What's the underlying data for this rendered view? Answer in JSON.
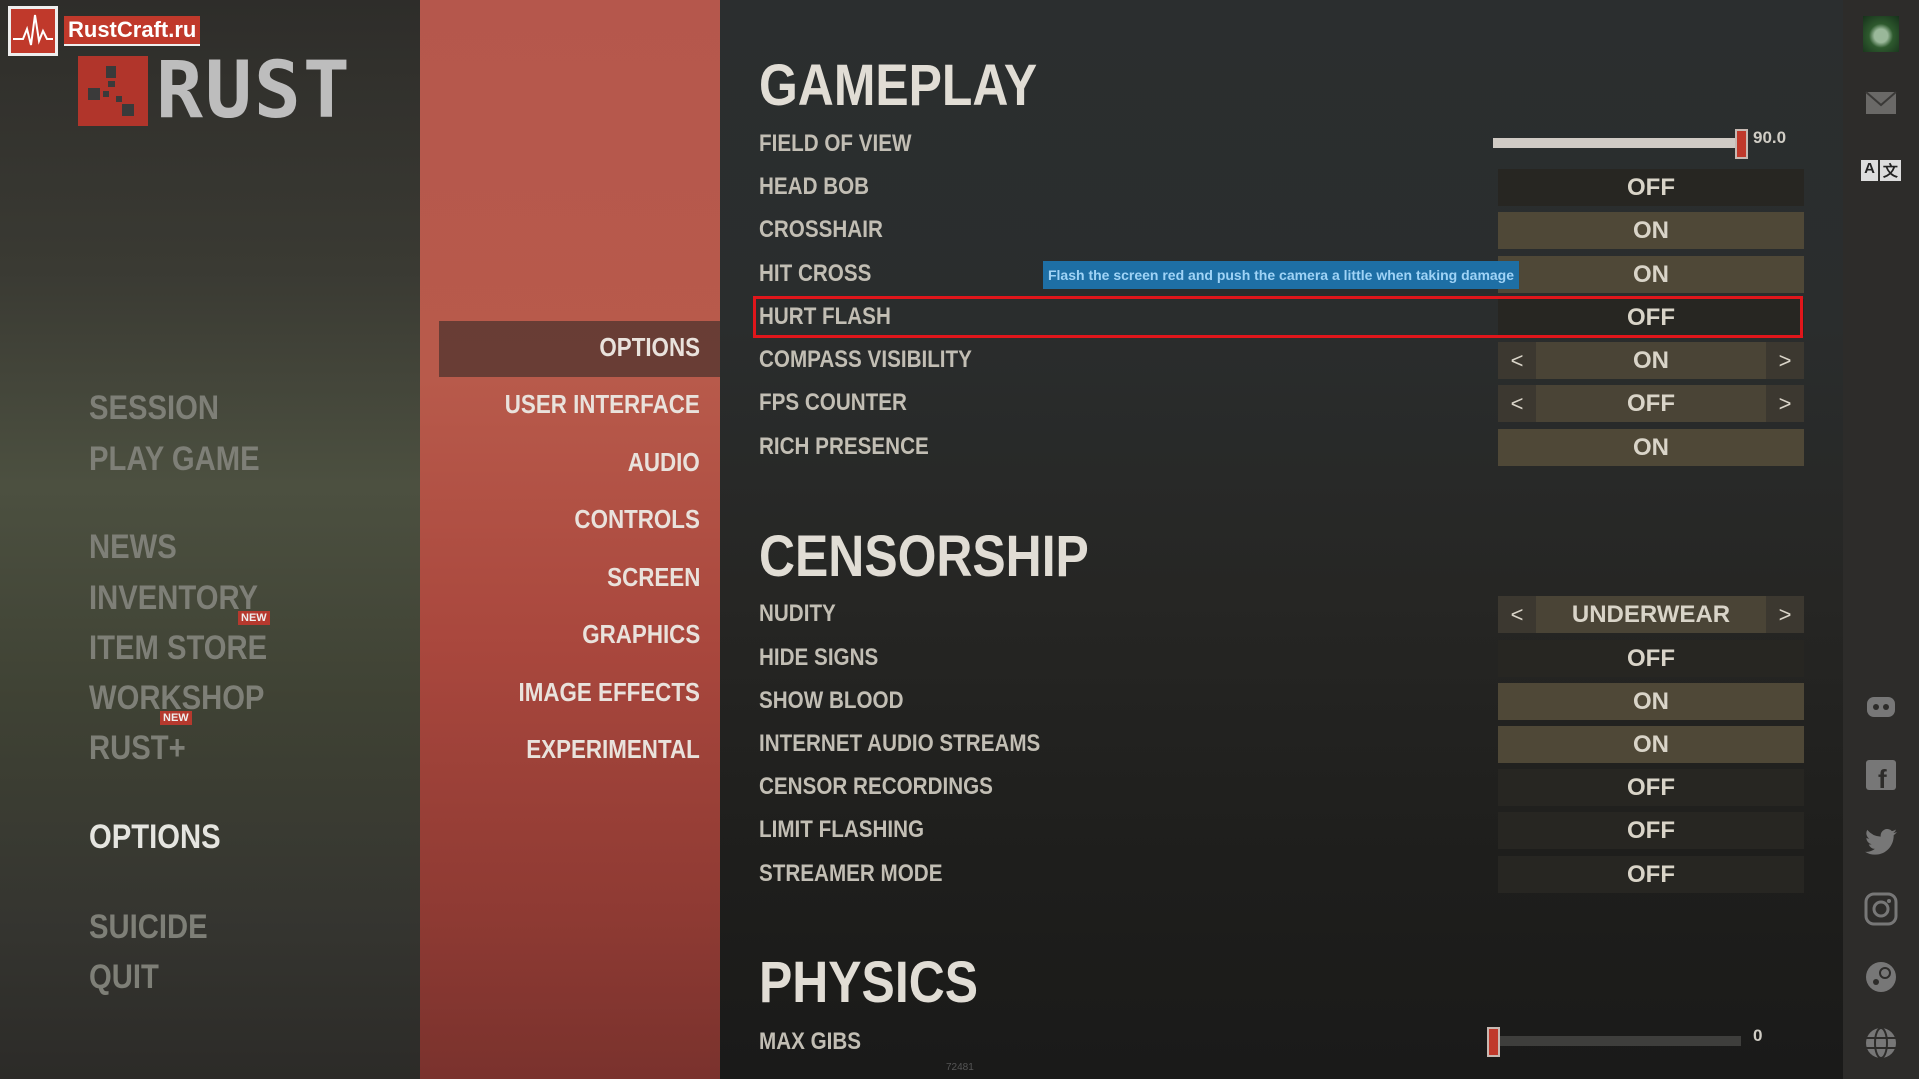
{
  "watermark": {
    "text": "RustCraft.ru"
  },
  "logo": {
    "text": "RUST"
  },
  "left_menu": [
    {
      "label": "SESSION",
      "active": false
    },
    {
      "label": "PLAY GAME",
      "active": false
    },
    {
      "label": "NEWS",
      "active": false
    },
    {
      "label": "INVENTORY",
      "active": false
    },
    {
      "label": "ITEM STORE",
      "active": false,
      "badge": "NEW"
    },
    {
      "label": "WORKSHOP",
      "active": false
    },
    {
      "label": "RUST+",
      "active": false,
      "badge": "NEW"
    },
    {
      "label": "OPTIONS",
      "active": true
    },
    {
      "label": "SUICIDE",
      "active": false
    },
    {
      "label": "QUIT",
      "active": false
    }
  ],
  "options_menu": [
    {
      "label": "OPTIONS",
      "selected": true
    },
    {
      "label": "USER INTERFACE"
    },
    {
      "label": "AUDIO"
    },
    {
      "label": "CONTROLS"
    },
    {
      "label": "SCREEN"
    },
    {
      "label": "GRAPHICS"
    },
    {
      "label": "IMAGE EFFECTS"
    },
    {
      "label": "EXPERIMENTAL"
    }
  ],
  "sections": [
    {
      "title": "GAMEPLAY",
      "rows": [
        {
          "label": "FIELD OF VIEW",
          "type": "slider",
          "value": "90.0",
          "fraction": 1.0
        },
        {
          "label": "HEAD BOB",
          "type": "toggle",
          "value": "OFF"
        },
        {
          "label": "CROSSHAIR",
          "type": "toggle",
          "value": "ON"
        },
        {
          "label": "HIT CROSS",
          "type": "toggle",
          "value": "ON"
        },
        {
          "label": "HURT FLASH",
          "type": "toggle",
          "value": "OFF",
          "highlighted": true
        },
        {
          "label": "COMPASS VISIBILITY",
          "type": "select",
          "value": "ON",
          "prev": "<",
          "next": ">"
        },
        {
          "label": "FPS COUNTER",
          "type": "select",
          "value": "OFF",
          "prev": "<",
          "next": ">"
        },
        {
          "label": "RICH PRESENCE",
          "type": "toggle",
          "value": "ON"
        }
      ]
    },
    {
      "title": "CENSORSHIP",
      "rows": [
        {
          "label": "NUDITY",
          "type": "select",
          "value": "UNDERWEAR",
          "prev": "<",
          "next": ">"
        },
        {
          "label": "HIDE SIGNS",
          "type": "toggle",
          "value": "OFF"
        },
        {
          "label": "SHOW BLOOD",
          "type": "toggle",
          "value": "ON"
        },
        {
          "label": "INTERNET AUDIO STREAMS",
          "type": "toggle",
          "value": "ON"
        },
        {
          "label": "CENSOR RECORDINGS",
          "type": "toggle",
          "value": "OFF"
        },
        {
          "label": "LIMIT FLASHING",
          "type": "toggle",
          "value": "OFF"
        },
        {
          "label": "STREAMER MODE",
          "type": "toggle",
          "value": "OFF"
        }
      ]
    },
    {
      "title": "PHYSICS",
      "rows": [
        {
          "label": "MAX GIBS",
          "type": "slider",
          "value": "0",
          "fraction": 0.0
        }
      ]
    }
  ],
  "tooltip": {
    "text": "Flash the screen red and push the camera a little when taking damage"
  },
  "build_number": "72481",
  "right_icons": [
    "avatar-icon",
    "mail-icon",
    "translate-icon",
    "discord-icon",
    "facebook-icon",
    "twitter-icon",
    "instagram-icon",
    "steam-icon",
    "globe-icon"
  ],
  "colors": {
    "accent": "#c0392b",
    "highlight_border": "#e0161b",
    "tooltip_bg": "#1e6fa5",
    "toggle_on": "#4f4837",
    "toggle_off": "#272622"
  }
}
